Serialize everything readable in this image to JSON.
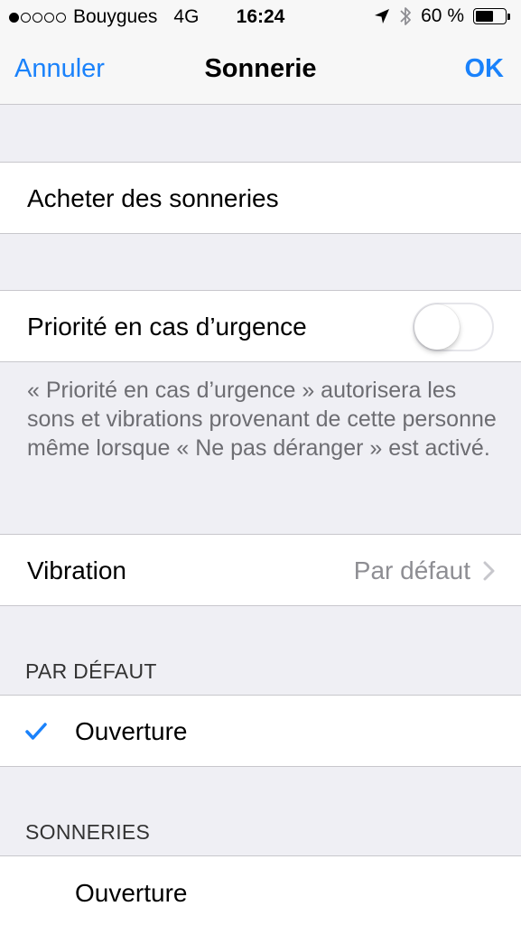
{
  "status_bar": {
    "carrier": "Bouygues",
    "network": "4G",
    "time": "16:24",
    "battery": "60 %",
    "battery_level": 0.6,
    "signal_bars": 1,
    "icons": [
      "location-icon",
      "bluetooth-icon",
      "battery-icon"
    ]
  },
  "nav": {
    "cancel": "Annuler",
    "title": "Sonnerie",
    "ok": "OK",
    "accent_color": "#1a82fb"
  },
  "store": {
    "label": "Acheter des sonneries"
  },
  "emergency": {
    "label": "Priorité en cas d’urgence",
    "toggle_on": false,
    "footer": "« Priorité en cas d’urgence » autorisera les sons et vibrations provenant de cette personne même lorsque « Ne pas déranger » est activé."
  },
  "vibration": {
    "label": "Vibration",
    "value": "Par défaut"
  },
  "default_section": {
    "header": "PAR DÉFAUT",
    "items": [
      {
        "label": "Ouverture",
        "selected": true
      }
    ]
  },
  "ringtones_section": {
    "header": "SONNERIES",
    "items": [
      {
        "label": "Ouverture",
        "selected": false
      }
    ]
  }
}
